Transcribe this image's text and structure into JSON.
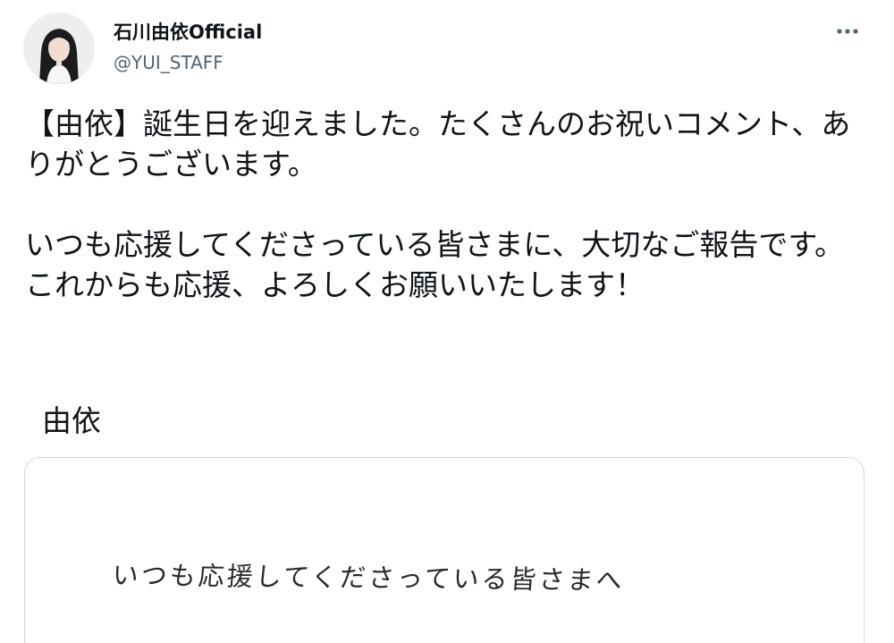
{
  "user": {
    "display_name": "石川由依Official",
    "handle": "@YUI_STAFF",
    "avatar_icon": "profile-photo"
  },
  "more_icon": "more-dots-icon",
  "tweet": {
    "paragraph_1": "【由依】誕生日を迎えました。たくさんのお祝いコメント、ありがとうございます。",
    "paragraph_2": "いつも応援してくださっている皆さまに、大切なご報告です。これからも応援、よろしくお願いいたします！",
    "signature": "由依"
  },
  "media": {
    "letter_first_line": "いつも応援してくださっている皆さまへ"
  },
  "colors": {
    "text": "#0f1419",
    "secondary": "#536471",
    "border": "#cfd9de"
  }
}
